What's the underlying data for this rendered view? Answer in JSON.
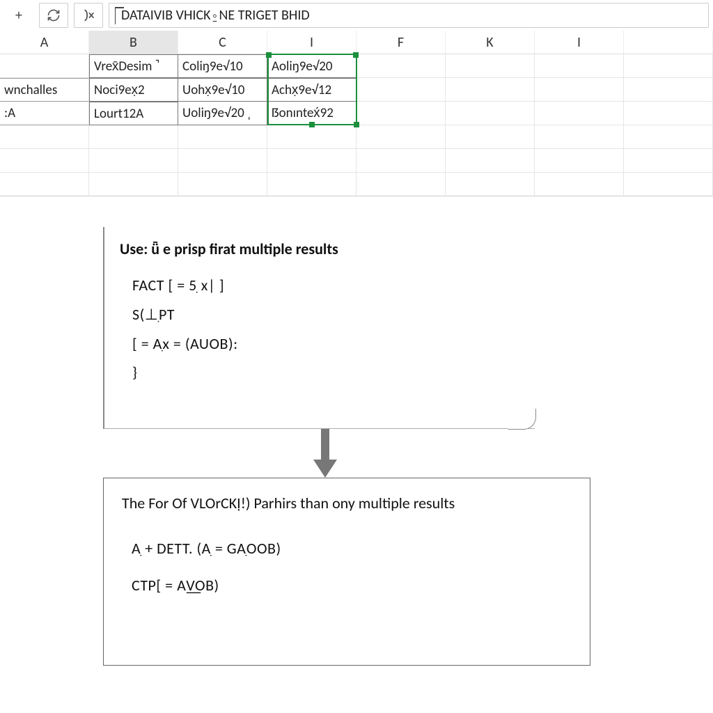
{
  "toolbar": {
    "plus": "+",
    "formula_text": "DATAIVIB VHICK⍛NE TRIGET BHID"
  },
  "columns": [
    "A",
    "B",
    "C",
    "I",
    "F",
    "K",
    "I",
    ""
  ],
  "rows": {
    "r1": {
      "a": "",
      "b": "Vrex̄Desim ˺",
      "c": "Coliŋ9e√10",
      "i": "Aoliŋ9e√20"
    },
    "r2": {
      "a": "wnchalles",
      "b": "Noci9ex̣2",
      "c": "Uohx̣9e√10",
      "i": "Achx̣9e√12"
    },
    "r3": {
      "a": ":A",
      "b": "Lourt12A",
      "c": "Uoliŋ9e√20 ˌ",
      "i": "ẞonıntex́92"
    }
  },
  "box1": {
    "title": "Use: ǖ e prisp firat multiple results",
    "l1": "FACT [ = 5ִ x| ]",
    "l2": "S(⊥ִPT",
    "l3": "[ = Aִx = (AUOB):",
    "l4": "}"
  },
  "box2": {
    "title": "The For Of VLOrCKỊ!) Parhirs than ony multiple results",
    "l1": "Aִ + DETT. (Aִ = GAִOOB)",
    "l2": "CTP[ = A͟VOB)"
  }
}
